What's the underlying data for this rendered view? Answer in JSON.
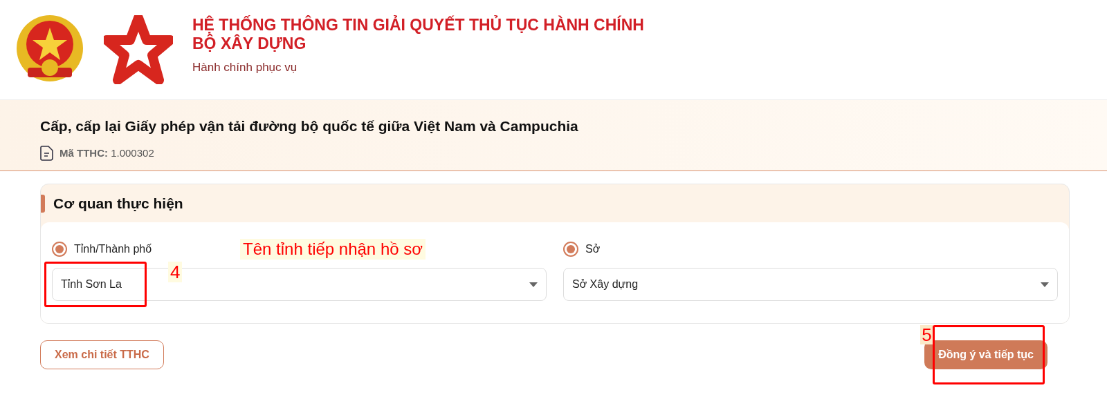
{
  "header": {
    "title_line_1": "HỆ THỐNG THÔNG TIN GIẢI QUYẾT THỦ TỤC HÀNH CHÍNH",
    "title_line_2": "BỘ XÂY DỰNG",
    "slogan": "Hành chính phục vụ"
  },
  "procedure": {
    "title": "Cấp, cấp lại Giấy phép vận tải đường bộ quốc tế giữa Việt Nam và Campuchia",
    "code_label": "Mã TTHC:",
    "code_value": "1.000302"
  },
  "agency_section": {
    "title": "Cơ quan thực hiện",
    "fields": [
      {
        "label": "Tỉnh/Thành phố",
        "selected": true,
        "value": "Tỉnh Sơn La"
      },
      {
        "label": "Sở",
        "selected": true,
        "value": "Sở Xây dựng"
      }
    ]
  },
  "buttons": [
    {
      "kind": "outline",
      "label": "Xem chi tiết TTHC"
    },
    {
      "kind": "primary",
      "label": "Đồng ý và tiếp tục"
    }
  ],
  "annotations": {
    "callout": "Tên tỉnh tiếp nhận hồ sơ",
    "step_select": "4",
    "step_button": "5"
  }
}
